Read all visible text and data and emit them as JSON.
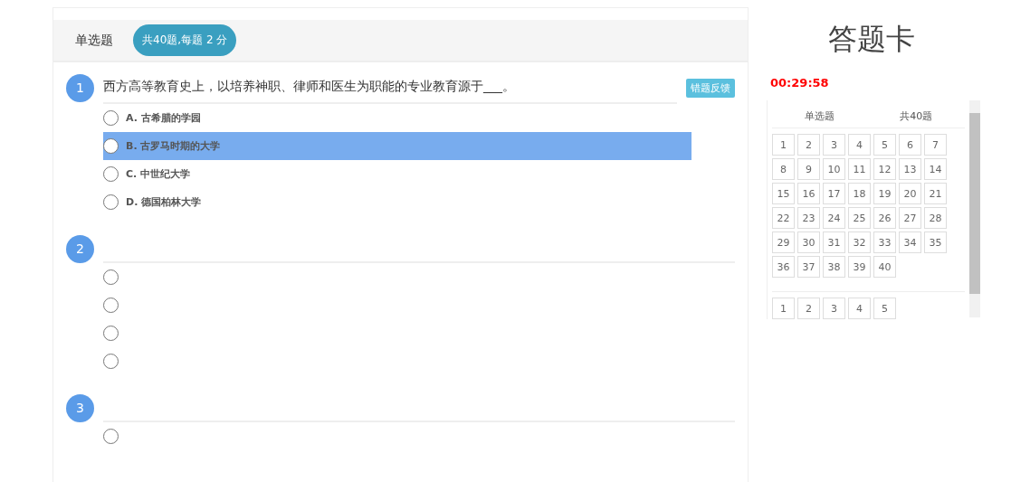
{
  "section_tab": {
    "label": "单选题",
    "summary": "共40题,每题 2 分"
  },
  "questions": [
    {
      "number": "1",
      "text": "西方高等教育史上，以培养神职、律师和医生为职能的专业教育源于___。",
      "feedback": "错题反馈",
      "options": [
        {
          "label": "A. 古希腊的学园",
          "selected": false
        },
        {
          "label": "B. 古罗马时期的大学",
          "selected": true
        },
        {
          "label": "C. 中世纪大学",
          "selected": false
        },
        {
          "label": "D. 德国柏林大学",
          "selected": false
        }
      ]
    },
    {
      "number": "2",
      "options": [
        {
          "selected": false
        },
        {
          "selected": false
        },
        {
          "selected": false
        },
        {
          "selected": false
        }
      ]
    },
    {
      "number": "3",
      "options": [
        {
          "selected": false
        }
      ]
    }
  ],
  "answer_card": {
    "title": "答题卡",
    "timer": "00:29:58",
    "groups": [
      {
        "name": "单选题",
        "count": "共40题",
        "cells": [
          "1",
          "2",
          "3",
          "4",
          "5",
          "6",
          "7",
          "8",
          "9",
          "10",
          "11",
          "12",
          "13",
          "14",
          "15",
          "16",
          "17",
          "18",
          "19",
          "20",
          "21",
          "22",
          "23",
          "24",
          "25",
          "26",
          "27",
          "28",
          "29",
          "30",
          "31",
          "32",
          "33",
          "34",
          "35",
          "36",
          "37",
          "38",
          "39",
          "40"
        ]
      },
      {
        "cells": [
          "1",
          "2",
          "3",
          "4",
          "5"
        ]
      }
    ]
  }
}
